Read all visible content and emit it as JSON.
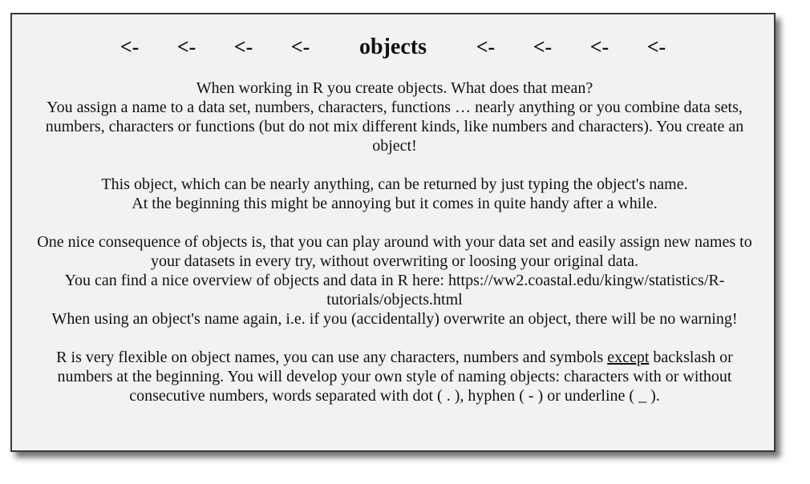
{
  "title": {
    "arrow": "<-",
    "text": "objects"
  },
  "paragraphs": {
    "p1": {
      "line1": "When working in R you create objects. What does that mean?",
      "line2": "You assign a name to a data set, numbers, characters, functions … nearly anything or you combine data sets, numbers, characters or functions (but do not mix different kinds, like numbers and characters). You create an object!"
    },
    "p2": {
      "line1": "This object, which can be nearly anything, can be returned by just typing the object's name.",
      "line2": "At the beginning this might be annoying but it comes in quite handy after a while."
    },
    "p3": {
      "line1": "One nice consequence of objects is, that you can play around with your data set and easily assign new names to your datasets in every try, without overwriting or loosing your original data.",
      "line2": "You can find a nice overview of objects and data in R here: https://ww2.coastal.edu/kingw/statistics/R-tutorials/objects.html",
      "line3": "When using an object's name again, i.e. if you (accidentally) overwrite an object, there will be no warning!"
    },
    "p4": {
      "before": "R is very flexible on object names, you can use any characters, numbers and symbols ",
      "underlined": "except",
      "after": " backslash or numbers at the beginning. You will develop your own style of naming objects: characters with or without consecutive numbers, words separated with dot ( . ), hyphen ( - ) or underline ( _ )."
    }
  }
}
